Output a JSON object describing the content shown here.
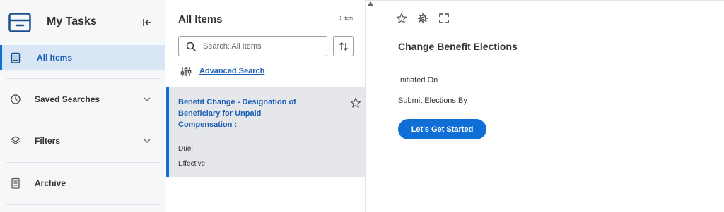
{
  "sidebar": {
    "title": "My Tasks",
    "items": [
      {
        "label": "All Items",
        "icon": "clipboard-icon",
        "active": true
      },
      {
        "label": "Saved Searches",
        "icon": "clock-icon"
      },
      {
        "label": "Filters",
        "icon": "layers-icon"
      },
      {
        "label": "Archive",
        "icon": "archive-icon"
      }
    ]
  },
  "list": {
    "title": "All Items",
    "count": "1 item",
    "search_placeholder": "Search: All Items",
    "advanced_search": "Advanced Search",
    "card": {
      "title": "Benefit Change - Designation of Beneficiary for Unpaid Compensation :",
      "due": "Due:",
      "effective": "Effective:"
    }
  },
  "detail": {
    "title": "Change Benefit Elections",
    "initiated_on": "Initiated On",
    "submit_by": "Submit Elections By",
    "button": "Let's Get Started"
  },
  "colors": {
    "accent": "#0f6fd6",
    "link": "#1b5fb5",
    "sidebar_bg": "#f6f7f8",
    "active_bg": "#d9e6f6",
    "card_bg": "#e5e7ea"
  }
}
